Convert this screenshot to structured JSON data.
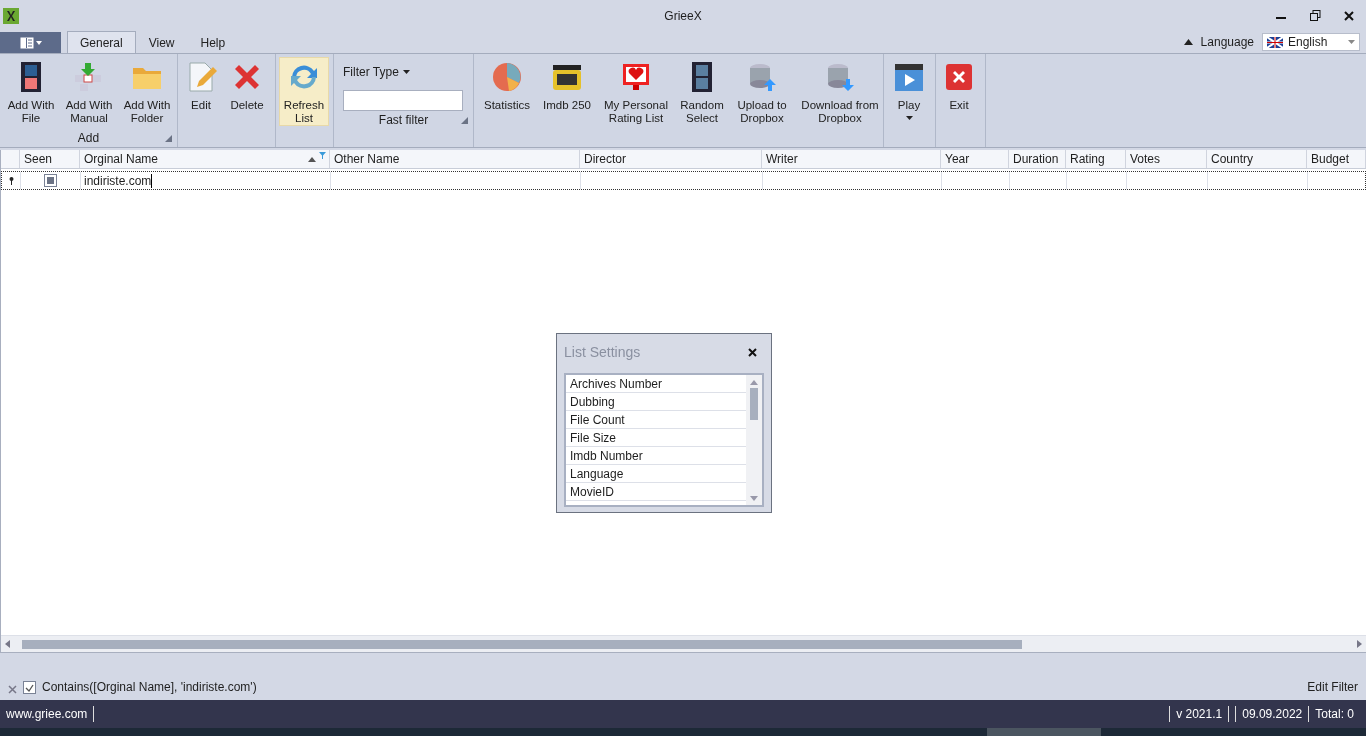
{
  "window": {
    "title": "GrieeX"
  },
  "tabs": [
    {
      "label": "General",
      "selected": true
    },
    {
      "label": "View",
      "selected": false
    },
    {
      "label": "Help",
      "selected": false
    }
  ],
  "language": {
    "label": "Language",
    "value": "English"
  },
  "ribbon": {
    "groups": [
      {
        "label": "Add",
        "launcher": true,
        "items": [
          {
            "label": "Add With File",
            "highlighted": false
          },
          {
            "label": "Add With Manual",
            "highlighted": false
          },
          {
            "label": "Add With Folder",
            "highlighted": false
          }
        ]
      },
      {
        "items": [
          {
            "label": "Edit",
            "highlighted": false
          },
          {
            "label": "Delete",
            "highlighted": false
          }
        ]
      },
      {
        "items": [
          {
            "label": "Refresh List",
            "highlighted": true
          }
        ]
      },
      {
        "label": "Fast filter",
        "launcher": true,
        "filter": {
          "label": "Filter Type"
        }
      },
      {
        "items": [
          {
            "label": "Statistics",
            "highlighted": false
          },
          {
            "label": "Imdb 250",
            "highlighted": false
          },
          {
            "label": "My Personal Rating List",
            "highlighted": false
          },
          {
            "label": "Random Select",
            "highlighted": false
          },
          {
            "label": "Upload to Dropbox",
            "highlighted": false
          },
          {
            "label": "Download from Dropbox",
            "highlighted": false
          }
        ]
      },
      {
        "items": [
          {
            "label": "Play",
            "highlighted": false,
            "dropdown": true
          }
        ]
      },
      {
        "items": [
          {
            "label": "Exit",
            "highlighted": false
          }
        ]
      }
    ]
  },
  "grid": {
    "columns": [
      {
        "label": "Seen",
        "sorted": false,
        "filtered": false
      },
      {
        "label": "Orginal Name",
        "sorted": true,
        "filtered": true
      },
      {
        "label": "Other Name",
        "sorted": false,
        "filtered": false
      },
      {
        "label": "Director",
        "sorted": false,
        "filtered": false
      },
      {
        "label": "Writer",
        "sorted": false,
        "filtered": false
      },
      {
        "label": "Year",
        "sorted": false,
        "filtered": false
      },
      {
        "label": "Duration",
        "sorted": false,
        "filtered": false
      },
      {
        "label": "Rating",
        "sorted": false,
        "filtered": false
      },
      {
        "label": "Votes",
        "sorted": false,
        "filtered": false
      },
      {
        "label": "Country",
        "sorted": false,
        "filtered": false
      },
      {
        "label": "Budget",
        "sorted": false,
        "filtered": false
      }
    ],
    "filter_row": {
      "seen_indeterminate": true,
      "value": "indiriste.com"
    }
  },
  "list_settings": {
    "title": "List Settings",
    "items": [
      "Archives Number",
      "Dubbing",
      "File Count",
      "File Size",
      "Imdb Number",
      "Language",
      "MovieID"
    ]
  },
  "filter_panel": {
    "checked": true,
    "expression": "Contains([Orginal Name], 'indiriste.com')",
    "edit_label": "Edit Filter"
  },
  "status_bar": {
    "website": "www.griee.com",
    "version": "v 2021.1",
    "date": "09.09.2022",
    "total": "Total: 0"
  }
}
